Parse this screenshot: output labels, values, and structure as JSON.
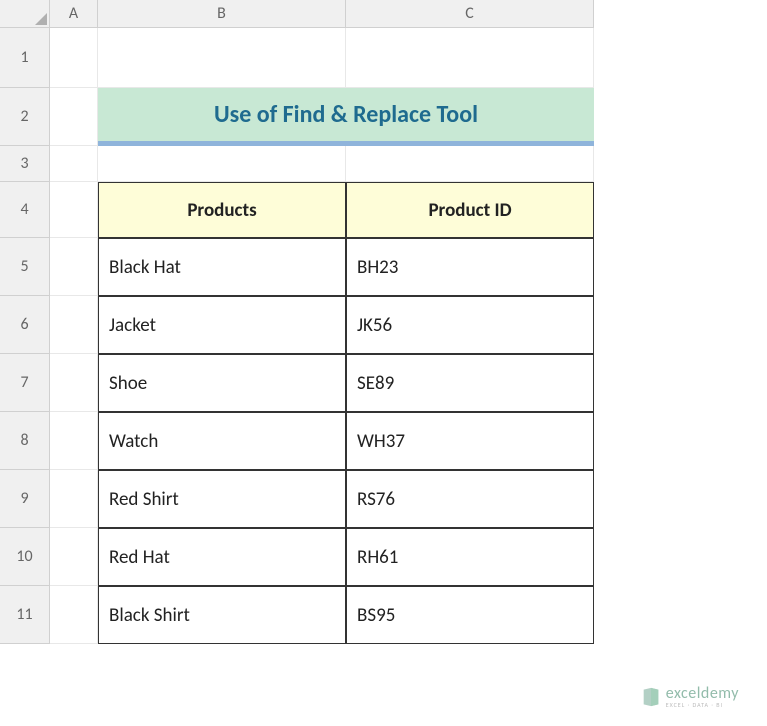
{
  "columns": [
    "A",
    "B",
    "C"
  ],
  "rows": [
    "1",
    "2",
    "3",
    "4",
    "5",
    "6",
    "7",
    "8",
    "9",
    "10",
    "11"
  ],
  "title": "Use of Find & Replace Tool",
  "table": {
    "headers": [
      "Products",
      "Product ID"
    ],
    "rows": [
      {
        "product": "Black Hat",
        "id": "BH23"
      },
      {
        "product": "Jacket",
        "id": "JK56"
      },
      {
        "product": "Shoe",
        "id": "SE89"
      },
      {
        "product": "Watch",
        "id": "WH37"
      },
      {
        "product": "Red Shirt",
        "id": "RS76"
      },
      {
        "product": "Red Hat",
        "id": "RH61"
      },
      {
        "product": "Black Shirt",
        "id": "BS95"
      }
    ]
  },
  "watermark": {
    "main": "exceldemy",
    "sub": "EXCEL · DATA · BI"
  }
}
